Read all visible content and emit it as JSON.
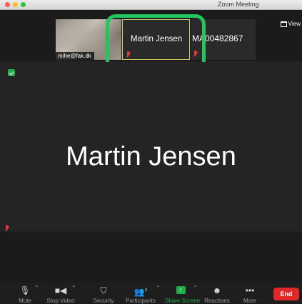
{
  "window": {
    "title": "Zoom Meeting"
  },
  "view_button": {
    "label": "View"
  },
  "thumbnails": [
    {
      "name": "mihe@fak.dk",
      "muted": false
    },
    {
      "name": "Martin Jensen",
      "muted": true,
      "active_speaker": true
    },
    {
      "name": "MA00482867",
      "muted": true
    }
  ],
  "main_view": {
    "name": "Martin Jensen",
    "muted": true
  },
  "toolbar": {
    "mute": "Mute",
    "stop_video": "Stop Video",
    "security": "Security",
    "participants": "Participants",
    "participants_count": "3",
    "share_screen": "Share Screen",
    "reactions": "Reactions",
    "more": "More",
    "end": "End"
  },
  "colors": {
    "highlight": "#22c55e",
    "share": "#1fae4a",
    "end": "#e02828"
  }
}
